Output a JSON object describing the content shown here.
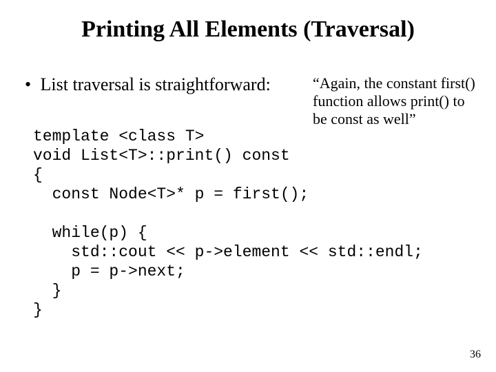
{
  "title": "Printing All Elements (Traversal)",
  "bullet": {
    "marker": "•",
    "text": "List traversal is straightforward:"
  },
  "note": "“Again, the constant first() function allows print() to be const as well”",
  "code": "template <class T>\nvoid List<T>::print() const\n{\n  const Node<T>* p = first();\n\n  while(p) {\n    std::cout << p->element << std::endl;\n    p = p->next;\n  }\n}",
  "page_number": "36"
}
